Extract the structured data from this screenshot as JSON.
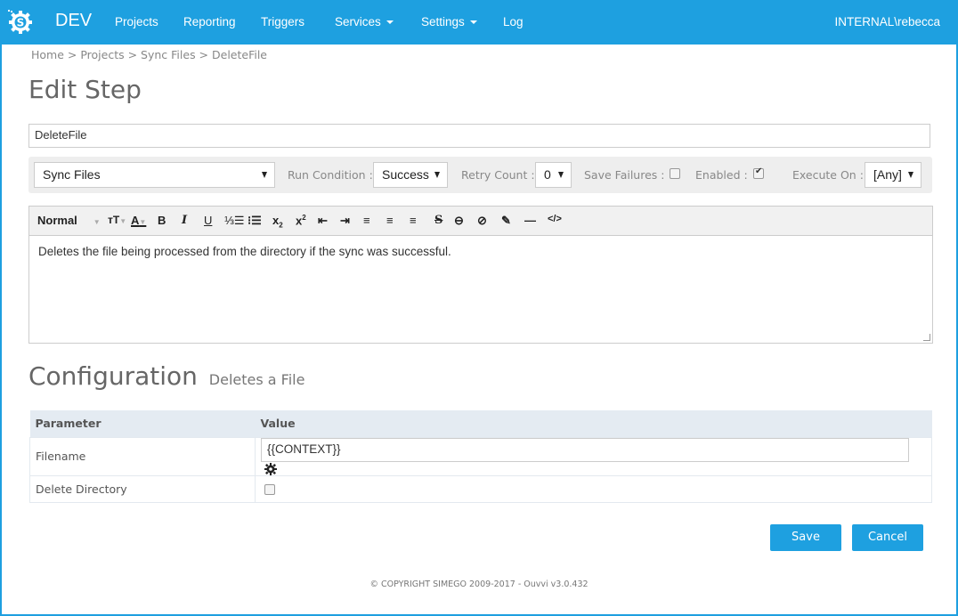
{
  "navbar": {
    "brand": "DEV",
    "items": [
      {
        "label": "Projects",
        "dropdown": false
      },
      {
        "label": "Reporting",
        "dropdown": false
      },
      {
        "label": "Triggers",
        "dropdown": false
      },
      {
        "label": "Services",
        "dropdown": true
      },
      {
        "label": "Settings",
        "dropdown": true
      },
      {
        "label": "Log",
        "dropdown": false
      }
    ],
    "user": "INTERNAL\\rebecca"
  },
  "breadcrumb": [
    "Home",
    "Projects",
    "Sync Files",
    "DeleteFile"
  ],
  "breadcrumb_separator": " > ",
  "page_title": "Edit Step",
  "step_name": "DeleteFile",
  "options": {
    "project": "Sync Files",
    "run_condition_label": "Run Condition :",
    "run_condition": "Success",
    "retry_count_label": "Retry Count :",
    "retry_count": "0",
    "save_failures_label": "Save Failures :",
    "save_failures": false,
    "enabled_label": "Enabled :",
    "enabled": true,
    "execute_on_label": "Execute On :",
    "execute_on": "[Any]"
  },
  "editor": {
    "format": "Normal",
    "content": "Deletes the file being processed from the directory if the sync was successful."
  },
  "config": {
    "title": "Configuration",
    "subtitle": "Deletes a File",
    "columns": [
      "Parameter",
      "Value"
    ],
    "rows": [
      {
        "parameter": "Filename",
        "value": "{{CONTEXT}}"
      },
      {
        "parameter": "Delete Directory",
        "checked": false
      }
    ]
  },
  "buttons": {
    "save": "Save",
    "cancel": "Cancel"
  },
  "footer": "© COPYRIGHT SIMEGO 2009-2017 - Ouvvi v3.0.432",
  "colors": {
    "accent": "#1ea0e0"
  }
}
